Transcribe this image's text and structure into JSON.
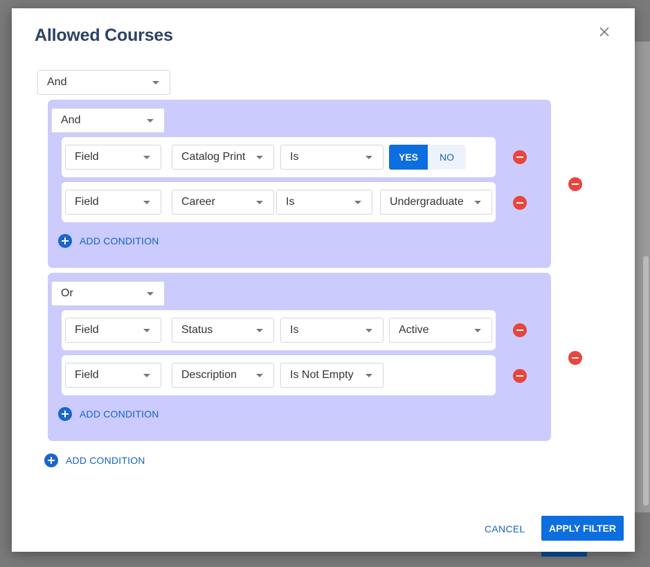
{
  "dialog": {
    "title": "Allowed Courses",
    "close_icon": "close-icon"
  },
  "root_operator": "And",
  "groups": [
    {
      "operator": "And",
      "conditions": [
        {
          "type": "Field",
          "field": "Catalog Print",
          "op": "Is",
          "toggle": {
            "yes": "YES",
            "no": "NO",
            "selected": "YES"
          }
        },
        {
          "type": "Field",
          "field": "Career",
          "op": "Is",
          "value": "Undergraduate"
        }
      ],
      "add_condition": "ADD CONDITION"
    },
    {
      "operator": "Or",
      "conditions": [
        {
          "type": "Field",
          "field": "Status",
          "op": "Is",
          "value": "Active"
        },
        {
          "type": "Field",
          "field": "Description",
          "op": "Is Not Empty"
        }
      ],
      "add_condition": "ADD CONDITION"
    }
  ],
  "add_condition": "ADD CONDITION",
  "footer": {
    "cancel": "CANCEL",
    "apply": "APPLY FILTER"
  },
  "colors": {
    "title": "#2c4262",
    "group_bg": "#cccbfd",
    "primary": "#0d6ee0",
    "link": "#1463c4",
    "remove": "#e8453c"
  }
}
